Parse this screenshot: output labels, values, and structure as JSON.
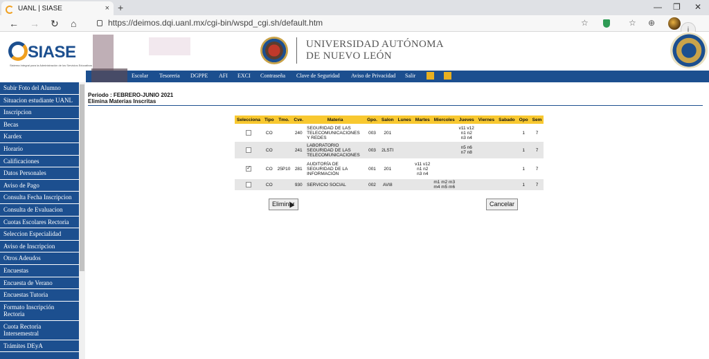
{
  "browser": {
    "tab_title": "UANL | SIASE",
    "tab_close": "×",
    "new_tab": "+",
    "url": "https://deimos.dqi.uanl.mx/cgi-bin/wspd_cgi.sh/default.htm",
    "nav": {
      "back": "←",
      "forward": "→",
      "refresh": "↻",
      "home": "⌂"
    },
    "window": {
      "minimize": "—",
      "restore": "❐",
      "close": "✕"
    },
    "toolbar": {
      "star": "☆",
      "favorites": "☆",
      "collections": "⊕",
      "more": "…"
    }
  },
  "header": {
    "logo_word": "SIASE",
    "logo_tag": "Sistema Integral para la Administración de los Servicios Educativos",
    "university_line1": "UNIVERSIDAD AUTÓNOMA",
    "university_line2": "DE NUEVO LEÓN"
  },
  "topnav": [
    "Escolar",
    "Tesoreria",
    "DGPPE",
    "AFI",
    "EXCI",
    "Contraseña",
    "Clave de Seguridad",
    "Aviso de Privacidad",
    "Salir"
  ],
  "sidebar": [
    "Subir Foto del Alumno",
    "Situacion estudiante UANL",
    "Inscripcion",
    "Becas",
    "Kardex",
    "Horario",
    "Calificaciones",
    "Datos Personales",
    "Aviso de Pago",
    "Consulta Fecha Inscripcion",
    "Consulta de Evaluacion",
    "Cuotas Escolares Rectoria",
    "Seleccion Especialidad",
    "Aviso de Inscripcion",
    "Otros Adeudos",
    "Encuestas",
    "Encuesta de Verano",
    "Encuestas Tutoria",
    "Formato Inscripción Rectoria",
    "Cuota Rectoria Intersemestral",
    "Trámites DEyA"
  ],
  "main": {
    "period_label": "Periodo :  FEBRERO-JUNIO 2021",
    "subtitle": "Elimina Materias Inscritas",
    "table": {
      "headers": [
        "Selecciona",
        "Tipo",
        "Tmo.",
        "Cve.",
        "Materia",
        "Gpo.",
        "Salon",
        "Lunes",
        "Martes",
        "Miercoles",
        "Jueves",
        "Viernes",
        "Sabado",
        "Opo",
        "Sem"
      ],
      "rows": [
        {
          "checked": false,
          "tipo": "CO",
          "tmo": "",
          "cve": "240",
          "materia": "SEGURIDAD DE LAS TELECOMUNICACIONES Y REDES",
          "gpo": "003",
          "salon": "201",
          "lunes": "",
          "martes": "",
          "miercoles": "",
          "jueves": "v11 v12 n1 n2 n3 n4",
          "viernes": "",
          "sabado": "",
          "opo": "1",
          "sem": "7"
        },
        {
          "checked": false,
          "tipo": "CO",
          "tmo": "",
          "cve": "241",
          "materia": "LABORATORIO SEGURIDAD DE LAS TELECOMUNICACIONES",
          "gpo": "003",
          "salon": "2LSTI",
          "lunes": "",
          "martes": "",
          "miercoles": "",
          "jueves": "n5 n6 n7 n8",
          "viernes": "",
          "sabado": "",
          "opo": "1",
          "sem": "7"
        },
        {
          "checked": true,
          "tipo": "CO",
          "tmo": "25P10",
          "cve": "281",
          "materia": "AUDITORÍA DE SEGURIDAD DE LA INFORMACIÓN",
          "gpo": "001",
          "salon": "201",
          "lunes": "",
          "martes": "v11 v12 n1 n2 n3 n4",
          "miercoles": "",
          "jueves": "",
          "viernes": "",
          "sabado": "",
          "opo": "1",
          "sem": "7"
        },
        {
          "checked": false,
          "tipo": "CO",
          "tmo": "",
          "cve": "930",
          "materia": "SERVICIO SOCIAL",
          "gpo": "002",
          "salon": "AVI8",
          "lunes": "",
          "martes": "",
          "miercoles": "m1 m2 m3 m4 m5 m6",
          "jueves": "",
          "viernes": "",
          "sabado": "",
          "opo": "1",
          "sem": "7"
        }
      ]
    },
    "delete_button": "Eliminar",
    "cancel_button": "Cancelar"
  }
}
